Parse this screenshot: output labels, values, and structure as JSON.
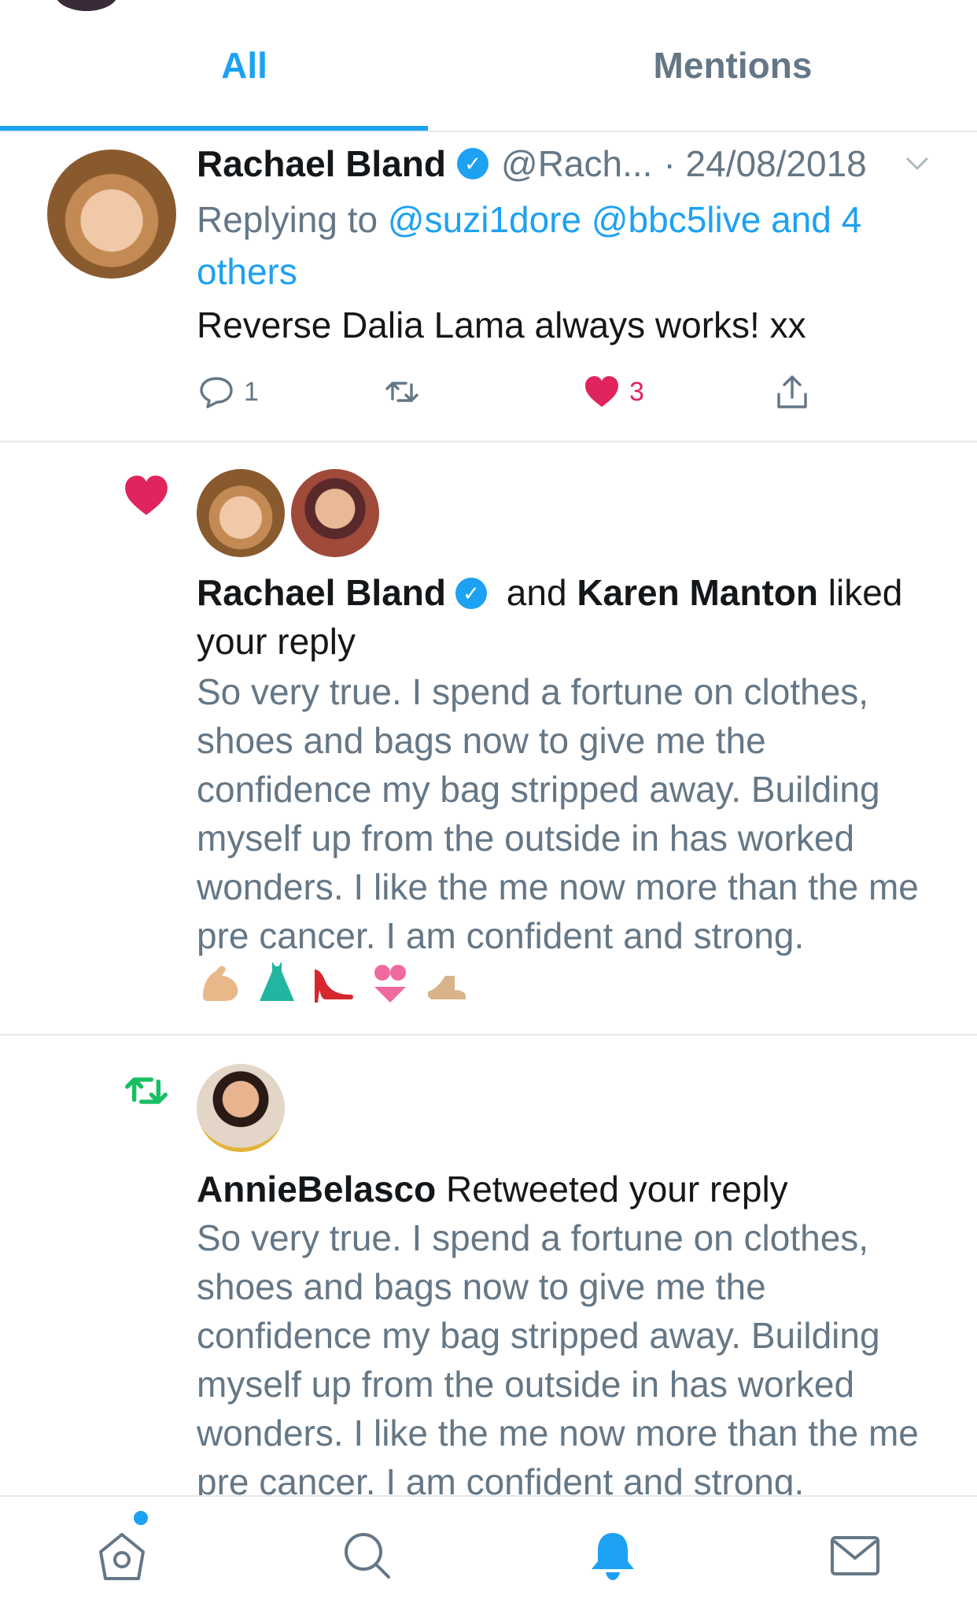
{
  "tabs": [
    {
      "label": "All",
      "active": true
    },
    {
      "label": "Mentions",
      "active": false
    }
  ],
  "tweet": {
    "name": "Rachael Bland",
    "handle": "@Rach...",
    "date": "· 24/08/2018",
    "replying_prefix": "Replying to ",
    "replying_links": "@suzi1dore @bbc5live and 4 others",
    "text": "Reverse Dalia Lama always works! xx",
    "reply_count": "1",
    "like_count": "3",
    "liked": true
  },
  "like_notification": {
    "name1": "Rachael Bland",
    "and": " and ",
    "name2": "Karen Manton",
    "action": " liked your reply",
    "body": "So very true. I spend a fortune on clothes, shoes and bags now to give me the confidence my bag stripped away. Building myself up from the outside in has worked wonders. I like the me now more than the me pre cancer. I am confident and strong.",
    "emojis": [
      "flexed-biceps",
      "dress",
      "high-heel",
      "bikini",
      "sandal"
    ]
  },
  "retweet_notification": {
    "name": "AnnieBelasco",
    "action": " Retweeted your reply",
    "body": "So very true. I spend a fortune on clothes, shoes and bags now to give me the confidence my bag stripped away. Building myself up from the outside in has worked wonders. I like the me now more than the me pre cancer. I am confident and strong."
  },
  "nav": {
    "items": [
      "home",
      "search",
      "notifications",
      "messages"
    ],
    "active": "notifications",
    "home_has_dot": true
  },
  "colors": {
    "accent": "#1da1f2",
    "like": "#e0245e",
    "retweet": "#17bf63",
    "muted": "#657786",
    "text": "#14171a"
  }
}
